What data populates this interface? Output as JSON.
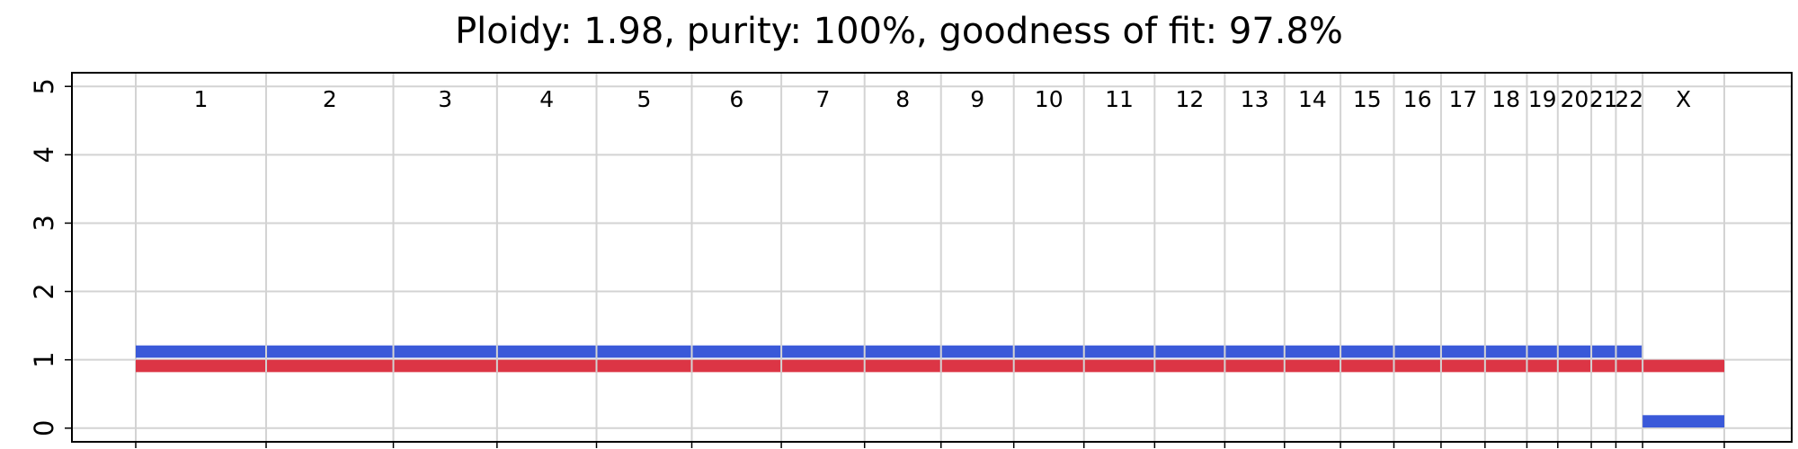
{
  "chart_data": {
    "type": "bar",
    "title": "Ploidy: 1.98, purity: 100%, goodness of fit: 97.8%",
    "xlabel": "",
    "ylabel": "",
    "ylim": [
      -0.2,
      5.2
    ],
    "yticks": [
      0,
      1,
      2,
      3,
      4,
      5
    ],
    "grid": true,
    "genome_range": [
      -0.41,
      5.28
    ],
    "chromosomes": [
      {
        "label": "1",
        "start": 0.0,
        "end": 0.249
      },
      {
        "label": "2",
        "start": 0.249,
        "end": 0.492
      },
      {
        "label": "3",
        "start": 0.492,
        "end": 0.69
      },
      {
        "label": "4",
        "start": 0.69,
        "end": 0.88
      },
      {
        "label": "5",
        "start": 0.88,
        "end": 1.062
      },
      {
        "label": "6",
        "start": 1.062,
        "end": 1.233
      },
      {
        "label": "7",
        "start": 1.233,
        "end": 1.392
      },
      {
        "label": "8",
        "start": 1.392,
        "end": 1.538
      },
      {
        "label": "9",
        "start": 1.538,
        "end": 1.677
      },
      {
        "label": "10",
        "start": 1.677,
        "end": 1.811
      },
      {
        "label": "11",
        "start": 1.811,
        "end": 1.946
      },
      {
        "label": "12",
        "start": 1.946,
        "end": 2.08
      },
      {
        "label": "13",
        "start": 2.08,
        "end": 2.194
      },
      {
        "label": "14",
        "start": 2.194,
        "end": 2.301
      },
      {
        "label": "15",
        "start": 2.301,
        "end": 2.403
      },
      {
        "label": "16",
        "start": 2.403,
        "end": 2.493
      },
      {
        "label": "17",
        "start": 2.493,
        "end": 2.577
      },
      {
        "label": "18",
        "start": 2.577,
        "end": 2.657
      },
      {
        "label": "19",
        "start": 2.657,
        "end": 2.716
      },
      {
        "label": "20",
        "start": 2.716,
        "end": 2.78
      },
      {
        "label": "21",
        "start": 2.78,
        "end": 2.827
      },
      {
        "label": "22",
        "start": 2.827,
        "end": 2.878
      },
      {
        "label": "X",
        "start": 2.878,
        "end": 3.034
      }
    ],
    "series": [
      {
        "color": "#3a59d9",
        "segments": [
          {
            "start": 0.0,
            "end": 2.878,
            "value": 1.12
          },
          {
            "start": 2.878,
            "end": 3.034,
            "value": 0.1
          }
        ]
      },
      {
        "color": "#dc3545",
        "segments": [
          {
            "start": 0.0,
            "end": 3.034,
            "value": 0.91
          }
        ]
      }
    ]
  }
}
